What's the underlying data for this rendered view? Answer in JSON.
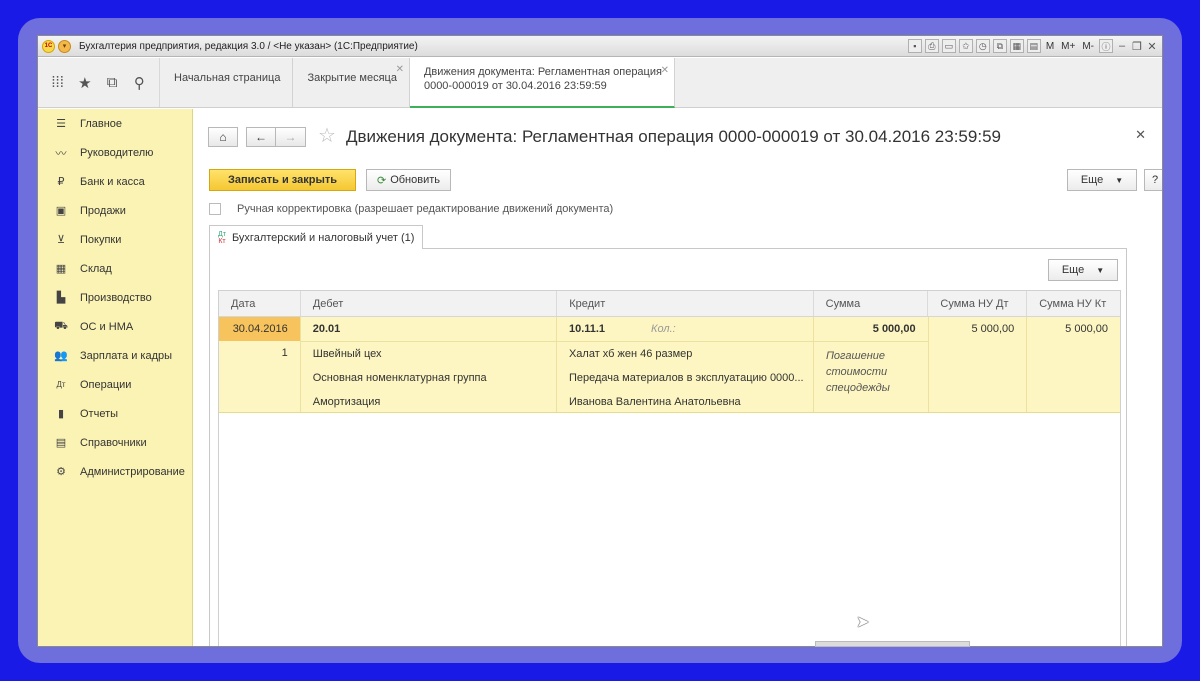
{
  "window": {
    "title": "Бухгалтерия предприятия, редакция 3.0 / <Не указан>  (1С:Предприятие)",
    "logo": "1С",
    "title_tools": [
      "M",
      "M+",
      "M-"
    ]
  },
  "tabs": [
    {
      "label": "Начальная страница",
      "closable": false
    },
    {
      "label": "Закрытие месяца",
      "closable": true
    },
    {
      "label_line1": "Движения документа: Регламентная операция",
      "label_line2": "0000-000019 от 30.04.2016 23:59:59",
      "closable": true,
      "active": true
    }
  ],
  "sidebar": {
    "items": [
      {
        "label": "Главное",
        "icon": "menu-lines-icon"
      },
      {
        "label": "Руководителю",
        "icon": "chart-line-icon"
      },
      {
        "label": "Банк и касса",
        "icon": "ruble-coin-icon"
      },
      {
        "label": "Продажи",
        "icon": "shopping-bag-icon"
      },
      {
        "label": "Покупки",
        "icon": "cart-icon"
      },
      {
        "label": "Склад",
        "icon": "warehouse-grid-icon"
      },
      {
        "label": "Производство",
        "icon": "factory-icon"
      },
      {
        "label": "ОС и НМА",
        "icon": "truck-icon"
      },
      {
        "label": "Зарплата и кадры",
        "icon": "people-icon"
      },
      {
        "label": "Операции",
        "icon": "dt-kt-icon"
      },
      {
        "label": "Отчеты",
        "icon": "bar-chart-icon"
      },
      {
        "label": "Справочники",
        "icon": "books-icon"
      },
      {
        "label": "Администрирование",
        "icon": "gear-icon"
      }
    ]
  },
  "document": {
    "title": "Движения документа: Регламентная операция 0000-000019 от 30.04.2016 23:59:59",
    "save_close": "Записать и закрыть",
    "refresh": "Обновить",
    "more": "Еще",
    "help": "?",
    "manual_edit": "Ручная корректировка (разрешает редактирование движений документа)",
    "subtab": "Бухгалтерский и налоговый учет (1)",
    "subtab_icon_top": "Дт",
    "subtab_icon_bottom": "Кт"
  },
  "grid": {
    "more": "Еще",
    "columns": [
      "Дата",
      "Дебет",
      "Кредит",
      "Сумма",
      "Сумма НУ Дт",
      "Сумма НУ Кт"
    ],
    "rows": [
      {
        "date": "30.04.2016",
        "num": "1",
        "debit_account": "20.01",
        "debit_sub": [
          "Швейный цех",
          "Основная номенклатурная группа",
          "Амортизация"
        ],
        "credit_account": "10.11.1",
        "credit_qty_label": "Кол.:",
        "credit_sub": [
          "Халат хб жен 46 размер",
          "Передача материалов в эксплуатацию 0000...",
          "Иванова Валентина Анатольевна"
        ],
        "sum": "5 000,00",
        "sum_note": "Погашение стоимости спецодежды",
        "sum_nu_dt": "5 000,00",
        "sum_nu_kt": "5 000,00"
      }
    ]
  }
}
